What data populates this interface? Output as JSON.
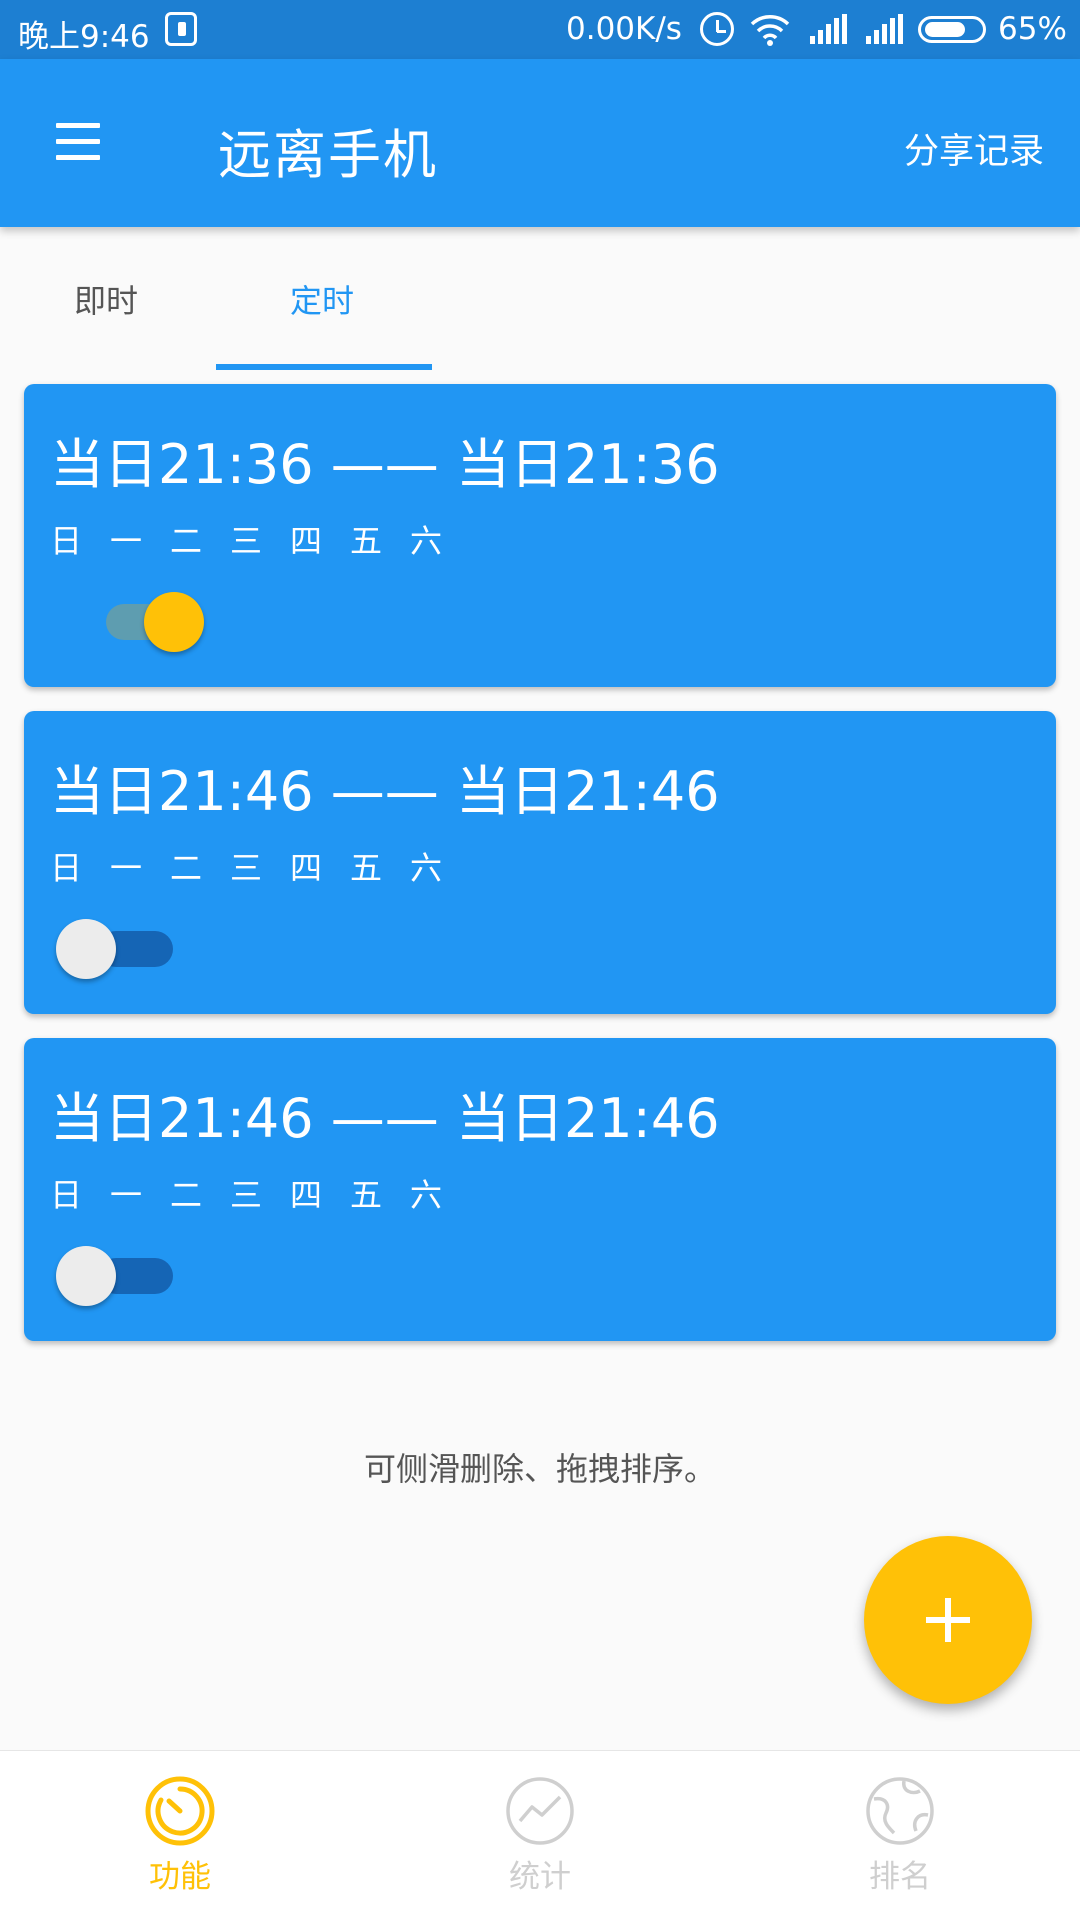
{
  "status_bar": {
    "time": "晚上9:46",
    "speed": "0.00K/s",
    "battery": "65%"
  },
  "app_bar": {
    "title": "远离手机",
    "share_label": "分享记录"
  },
  "tabs": [
    {
      "label": "即时",
      "selected": false
    },
    {
      "label": "定时",
      "selected": true
    }
  ],
  "cards": [
    {
      "time": "当日21:36 —— 当日21:36",
      "days": [
        "日",
        "一",
        "二",
        "三",
        "四",
        "五",
        "六"
      ],
      "enabled": true
    },
    {
      "time": "当日21:46 —— 当日21:46",
      "days": [
        "日",
        "一",
        "二",
        "三",
        "四",
        "五",
        "六"
      ],
      "enabled": false
    },
    {
      "time": "当日21:46 —— 当日21:46",
      "days": [
        "日",
        "一",
        "二",
        "三",
        "四",
        "五",
        "六"
      ],
      "enabled": false
    }
  ],
  "hint": "可侧滑删除、拖拽排序。",
  "fab": {
    "icon": "plus-icon"
  },
  "bottom_nav": [
    {
      "label": "功能",
      "icon": "timer-icon",
      "active": true
    },
    {
      "label": "统计",
      "icon": "chart-line-icon",
      "active": false
    },
    {
      "label": "排名",
      "icon": "globe-icon",
      "active": false
    }
  ],
  "colors": {
    "status_bar": "#1d7fd2",
    "primary": "#2196f3",
    "accent": "#ffc107",
    "background": "#fafafa"
  }
}
